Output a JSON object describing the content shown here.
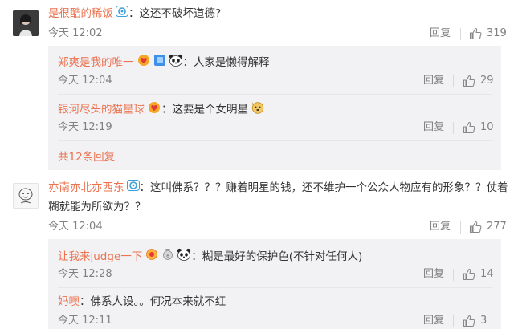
{
  "comments": [
    {
      "user": "是很酷的稀饭",
      "text": "：这还不破坏道德?",
      "time": "今天 12:02",
      "reply_label": "回复",
      "likes": "319"
    },
    {
      "user": "亦南亦北亦西东",
      "text_line1": "：这叫佛系？？？赚着明星的钱，还不维护一个公众人物应有的形象？？仗着",
      "text_line2": "糊就能为所欲为？？",
      "time": "今天 12:04",
      "reply_label": "回复",
      "likes": "277"
    }
  ],
  "replies_group1": [
    {
      "user": "郑爽是我的唯一",
      "text": "：人家是懒得解释",
      "time": "今天 12:04",
      "reply_label": "回复",
      "likes": "29"
    },
    {
      "user": "银河尽头的猫星球",
      "text": "：这要是个女明星",
      "time": "今天 12:19",
      "reply_label": "回复",
      "likes": "10"
    }
  ],
  "more_replies": "共12条回复",
  "replies_group2": [
    {
      "user": "让我来judge一下",
      "text": "：糊是最好的保护色(不针对任何人)",
      "time": "今天 12:28",
      "reply_label": "回复",
      "likes": "14"
    },
    {
      "user": "妈噢",
      "text": "：佛系人设。。何况本来就不红",
      "time": "今天 12:11",
      "reply_label": "回复",
      "likes": "3"
    }
  ],
  "icons": {
    "vip_badge": "vip-badge-icon",
    "thumb": "thumb-up-icon",
    "panda": "panda-emoji-icon",
    "dog": "dog-emoji-icon"
  },
  "colors": {
    "username": "#eb7350",
    "meta": "#808080",
    "reply_bg": "#f2f2f5"
  }
}
